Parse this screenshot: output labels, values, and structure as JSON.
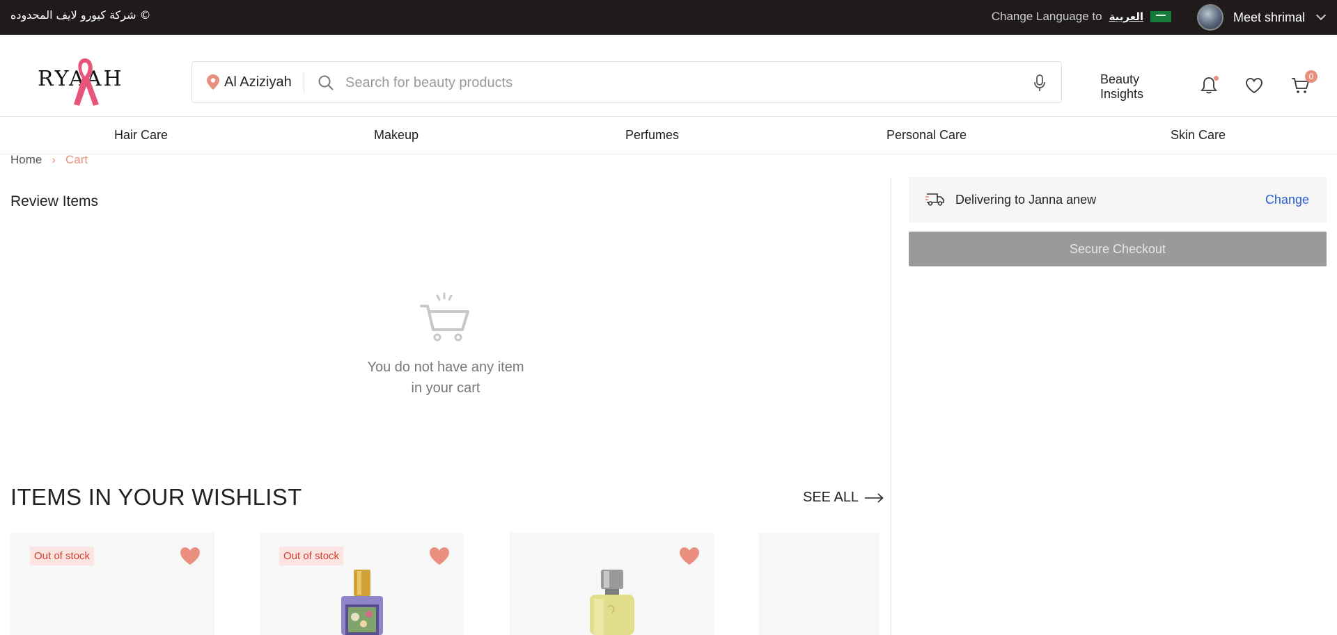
{
  "topbar": {
    "copyright": "© شركة كيورو لايف المحدوده",
    "change_language_label": "Change Language to",
    "language_option": "العربية",
    "user_name": "Meet shrimal"
  },
  "header": {
    "logo_text": "RYAAH",
    "location": "Al Aziziyah",
    "search_placeholder": "Search for beauty products",
    "beauty_insights": "Beauty Insights",
    "cart_count": "0"
  },
  "nav": {
    "items": [
      "Hair Care",
      "Makeup",
      "Perfumes",
      "Personal Care",
      "Skin Care"
    ]
  },
  "breadcrumb": {
    "home": "Home",
    "separator": "›",
    "current": "Cart"
  },
  "cart": {
    "review_title": "Review Items",
    "empty_line1": "You do not have any item",
    "empty_line2": "in your cart"
  },
  "wishlist": {
    "title": "ITEMS IN YOUR WISHLIST",
    "see_all": "SEE ALL",
    "cards": [
      {
        "badge": "Out of stock",
        "product": "none"
      },
      {
        "badge": "Out of stock",
        "product": "gucci-flora-bottle"
      },
      {
        "badge": "",
        "product": "yellow-perfume-bottle"
      },
      {
        "badge": "",
        "product": "none"
      }
    ]
  },
  "delivery": {
    "text": "Delivering to Janna anew",
    "change": "Change"
  },
  "checkout": {
    "label": "Secure Checkout"
  },
  "colors": {
    "accent": "#e8907e",
    "link": "#2a5fd6",
    "topbar": "#1e1b1a",
    "checkout_disabled": "#9a9a9a"
  }
}
